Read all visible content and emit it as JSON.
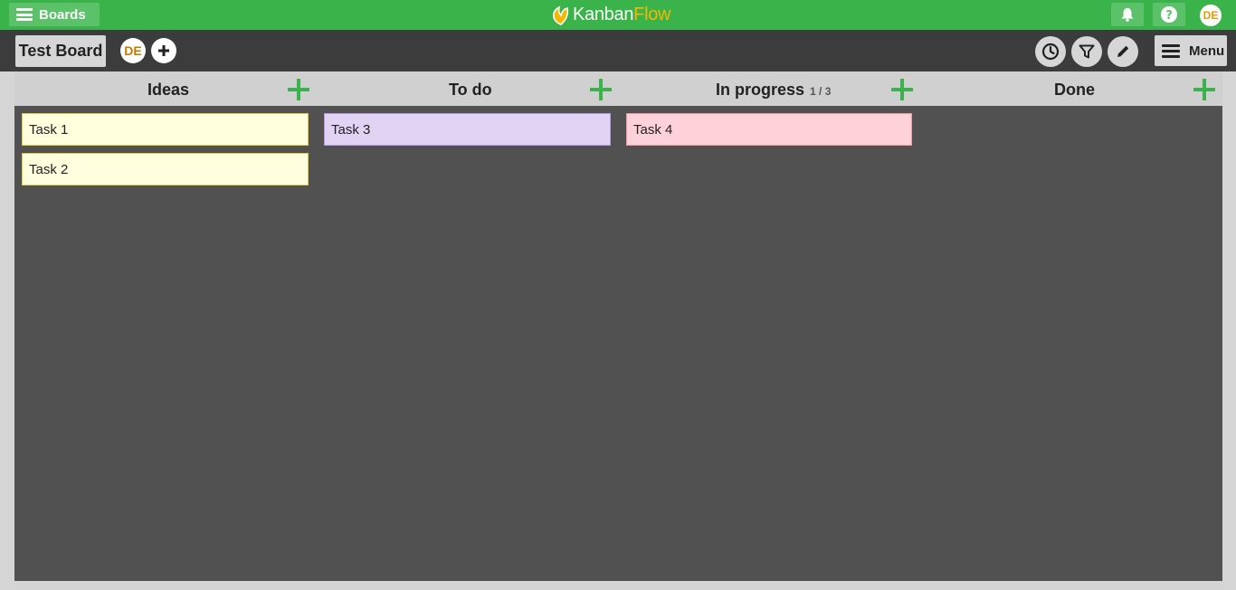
{
  "topbar": {
    "boards_label": "Boards",
    "logo": {
      "part1": "Kanban",
      "part2": "Flow"
    },
    "user_initials": "DE"
  },
  "board": {
    "title": "Test Board",
    "member_initials": "DE",
    "menu_label": "Menu"
  },
  "columns": [
    {
      "name": "Ideas",
      "wip": ""
    },
    {
      "name": "To do",
      "wip": ""
    },
    {
      "name": "In progress",
      "wip": "1 / 3"
    },
    {
      "name": "Done",
      "wip": ""
    }
  ],
  "tasks": [
    {
      "column": "Ideas",
      "name": "Task 1",
      "color": "#ffffdd",
      "border": "#e6c84a"
    },
    {
      "column": "Ideas",
      "name": "Task 2",
      "color": "#ffffdd",
      "border": "#e6c84a"
    },
    {
      "column": "To do",
      "name": "Task 3",
      "color": "#e2d2f4",
      "border": "#b79be0"
    },
    {
      "column": "In progress",
      "name": "Task 4",
      "color": "#ffd2d9",
      "border": "#ec9aa6"
    }
  ],
  "colors": {
    "brand_green": "#39b34a",
    "logo_accent": "#f5b800"
  }
}
